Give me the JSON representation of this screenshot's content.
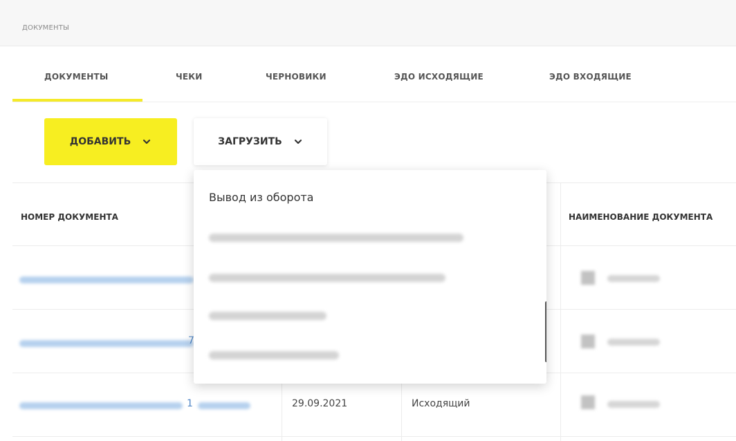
{
  "breadcrumb": "ДОКУМЕНТЫ",
  "tabs": [
    {
      "label": "ДОКУМЕНТЫ",
      "active": true
    },
    {
      "label": "ЧЕКИ",
      "active": false
    },
    {
      "label": "ЧЕРНОВИКИ",
      "active": false
    },
    {
      "label": "ЭДО ИСХОДЯЩИЕ",
      "active": false
    },
    {
      "label": "ЭДО ВХОДЯЩИЕ",
      "active": false
    }
  ],
  "toolbar": {
    "add_label": "ДОБАВИТЬ",
    "load_label": "ЗАГРУЗИТЬ"
  },
  "colors": {
    "accent": "#f7ee21",
    "link": "#4f86c6"
  },
  "table": {
    "headers": {
      "number": "НОМЕР ДОКУМЕНТА",
      "name": "НАИМЕНОВАНИЕ ДОКУМЕНТА"
    },
    "rows": [
      {
        "number_suffix": "",
        "date": "",
        "direction": ""
      },
      {
        "number_suffix": "7",
        "date": "",
        "direction": ""
      },
      {
        "number_suffix": "1",
        "date": "29.09.2021",
        "direction": "Исходящий"
      }
    ]
  },
  "dropdown": {
    "first_item": "Вывод из оборота"
  }
}
